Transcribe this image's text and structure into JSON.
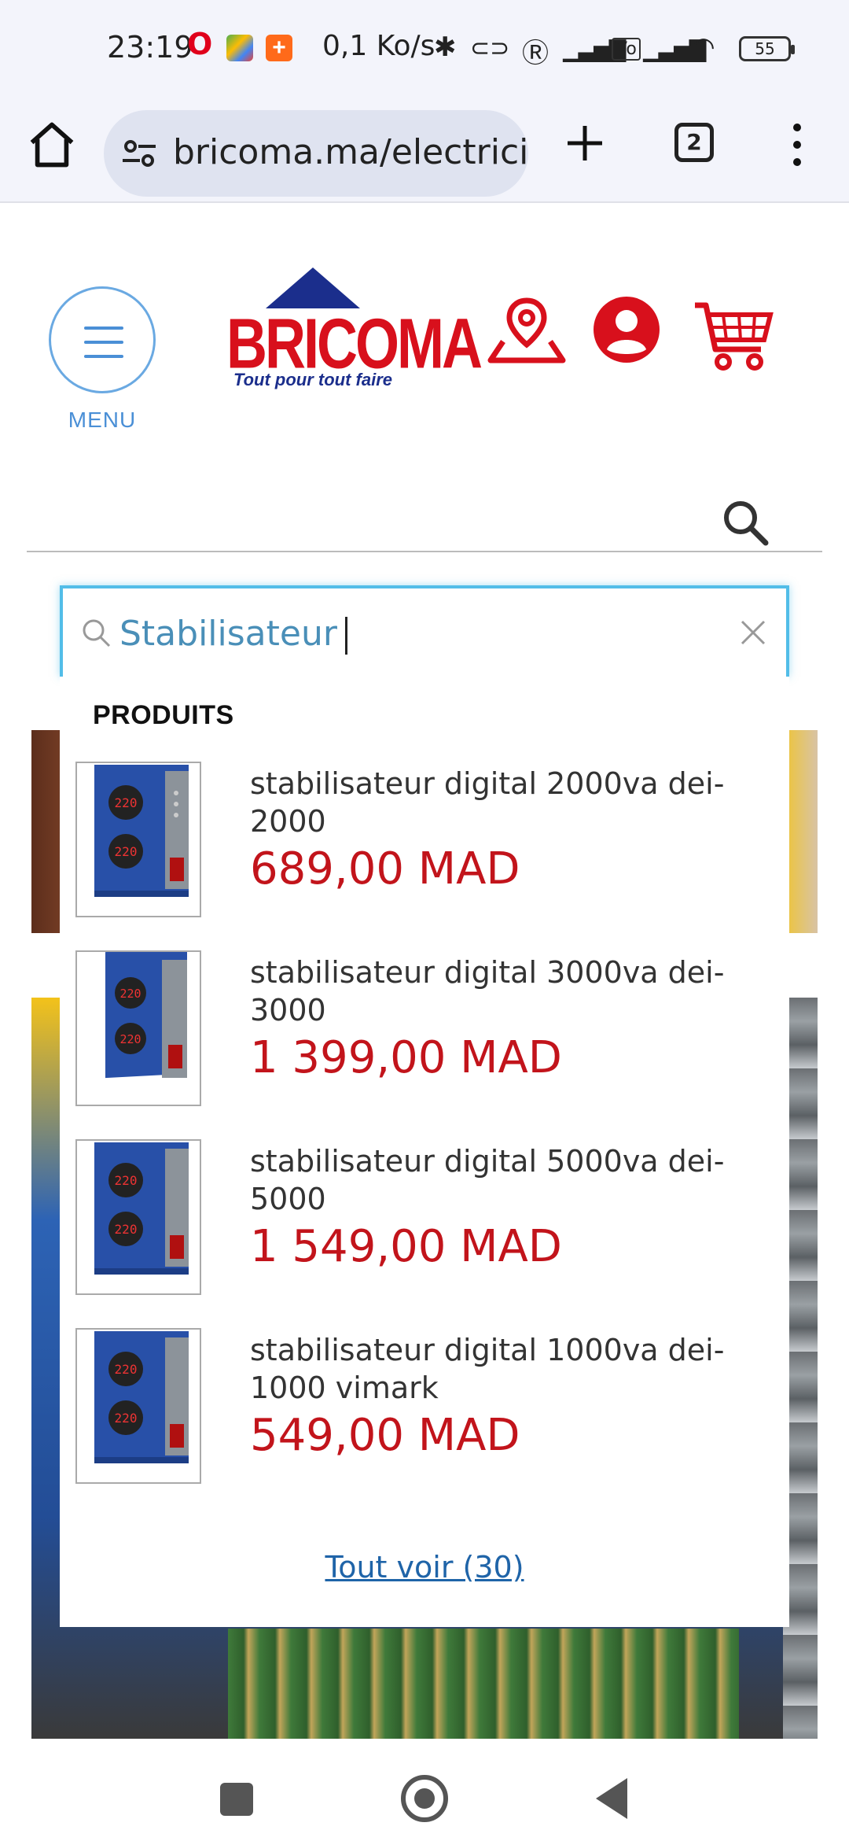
{
  "status_bar": {
    "time": "23:19",
    "speed": "0,1 Ko/s",
    "battery": "55"
  },
  "browser": {
    "url": "bricoma.ma/electricite",
    "tab_count": "2"
  },
  "site": {
    "menu_label": "MENU",
    "logo_name": "BRICOMA",
    "logo_tagline": "Tout pour tout faire",
    "brand_colors": {
      "red": "#d8101c",
      "blue": "#1b2e8c",
      "accent": "#52bde8"
    }
  },
  "search": {
    "value": "Stabilisateur"
  },
  "dropdown": {
    "heading": "PRODUITS",
    "results": [
      {
        "title": "stabilisateur  digital 2000va dei-2000",
        "price": "689,00 MAD"
      },
      {
        "title": "stabilisateur  digital 3000va dei-3000",
        "price": "1 399,00 MAD"
      },
      {
        "title": "stabilisateur  digital 5000va dei-5000",
        "price": "1 549,00 MAD"
      },
      {
        "title": "stabilisateur  digital 1000va dei-1000 vimark",
        "price": "549,00 MAD"
      }
    ],
    "see_all": "Tout voir (30)"
  }
}
